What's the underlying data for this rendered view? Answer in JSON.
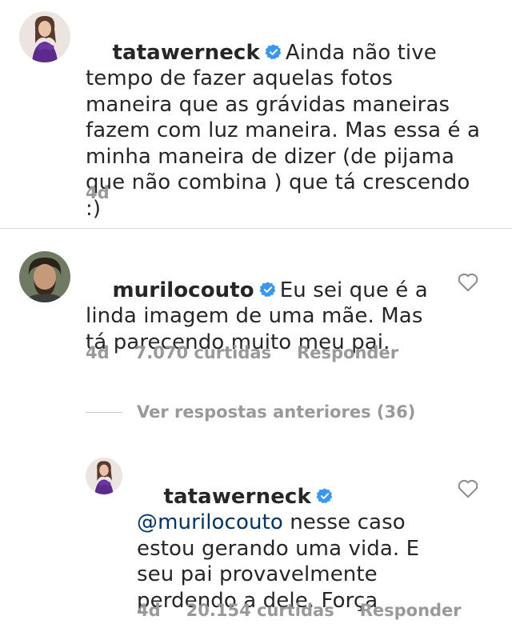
{
  "caption": {
    "username": "tatawerneck",
    "text": "Ainda não tive tempo de fazer aquelas fotos maneira que as grávidas maneiras fazem com luz maneira. Mas essa é a minha maneira de dizer (de pijama que não combina ) que tá crescendo :)",
    "time": "4d"
  },
  "comment": {
    "username": "murilocouto",
    "text": "Eu sei que é a linda imagem de uma mãe. Mas tá parecendo muito meu pai.",
    "time": "4d",
    "likes": "7.070 curtidas",
    "reply_label": "Responder"
  },
  "view_replies": {
    "label": "Ver respostas anteriores (36)"
  },
  "reply": {
    "username": "tatawerneck",
    "mention": "@murilocouto",
    "text": "nesse caso estou gerando uma vida. E seu pai provavelmente perdendo a dele. Força",
    "time": "4d",
    "likes": "20.154 curtidas",
    "reply_label": "Responder"
  },
  "colors": {
    "verified": "#3897f0",
    "mention": "#003569",
    "muted": "#999999"
  },
  "icons": {
    "verified": "verified-badge-icon",
    "like": "heart-outline-icon"
  }
}
